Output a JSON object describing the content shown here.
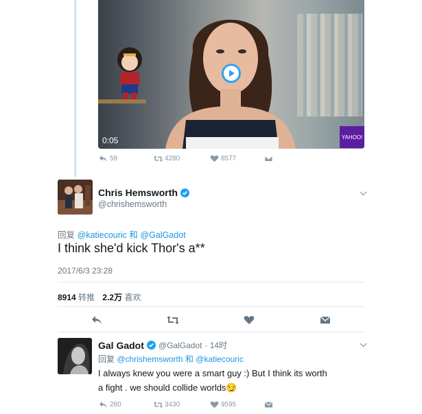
{
  "video": {
    "duration": "0:05",
    "watermark": "YAHOO!"
  },
  "media_stats": {
    "replies": "59",
    "retweets": "4280",
    "likes": "8577"
  },
  "main_tweet": {
    "name": "Chris Hemsworth",
    "handle": "@chrishemsworth",
    "reply_prefix": "回复",
    "reply_user1": "@katiecouric",
    "reply_and": "和",
    "reply_user2": "@GalGadot",
    "text": "I think she'd kick Thor's a**",
    "timestamp": "2017/6/3 23:28",
    "retweet_count": "8914",
    "retweet_label": "转推",
    "like_count": "2.2万",
    "like_label": "喜欢"
  },
  "reply_tweet": {
    "name": "Gal Gadot",
    "handle": "@GalGadot",
    "time": "· 14时",
    "reply_prefix": "回复",
    "reply_user1": "@chrishemsworth",
    "reply_and": "和",
    "reply_user2": "@katiecouric",
    "text_line1": "I always knew you were a smart guy :) But I think its worth",
    "text_line2": "a fight . we should collide worlds😏",
    "replies": "280",
    "retweets": "3430",
    "likes": "9595"
  },
  "colors": {
    "accent": "#1b95e0",
    "muted": "#657786",
    "icon": "#657786",
    "thread_line": "#cde4f2"
  },
  "icons": [
    "reply-icon",
    "retweet-icon",
    "like-icon",
    "dm-icon",
    "verified-icon",
    "chevron-down-icon",
    "play-icon"
  ]
}
